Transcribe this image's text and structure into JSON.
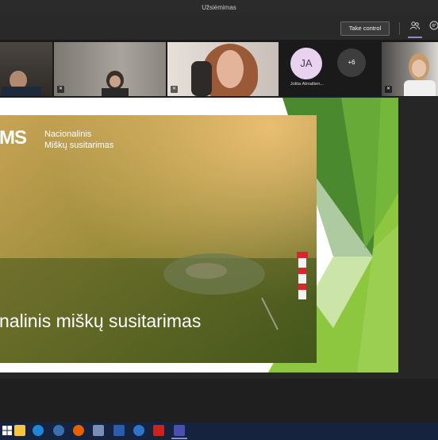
{
  "window": {
    "title": "Užsiėmimas"
  },
  "toolbar": {
    "take_control_label": "Take control",
    "participants_icon": "people-icon",
    "chat_icon": "chat-icon"
  },
  "participants": {
    "avatar_initials": "JA",
    "avatar_name": "Jolita Abraitien...",
    "more_count": "+6"
  },
  "slide": {
    "logo_mark": "MS",
    "logo_line1": "Nacionalinis",
    "logo_line2": "Miškų susitarimas",
    "title": "nalinis miškų susitarimas"
  },
  "taskbar": {
    "apps": [
      "start-icon",
      "file-explorer-icon",
      "edge-icon",
      "settings-icon",
      "firefox-icon",
      "save-icon",
      "word-icon",
      "onedrive-icon",
      "pdf-icon",
      "powerpoint-icon",
      "teams-icon"
    ]
  },
  "colors": {
    "accent_green": "#8dc63f",
    "dark_green": "#3f7e2c",
    "teams_purple": "#8b8cc7"
  }
}
